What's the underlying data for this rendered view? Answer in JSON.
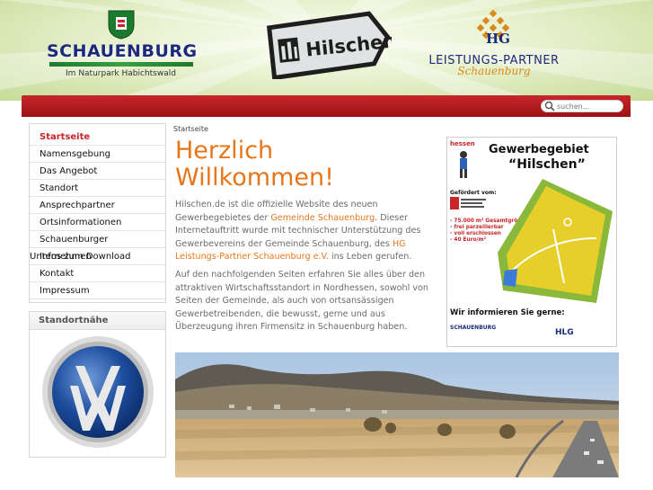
{
  "header": {
    "logo_left": {
      "name": "SCHAUENBURG",
      "subtitle": "Im Naturpark Habichtswald"
    },
    "logo_center": {
      "sign_text": "Hilschen"
    },
    "logo_right": {
      "monogram": "HG",
      "text": "LEISTUNGS-PARTNER",
      "script": "Schauenburg"
    }
  },
  "search": {
    "placeholder": "suchen..."
  },
  "sidebar": {
    "items": [
      {
        "label": "Startseite",
        "active": true
      },
      {
        "label": "Namensgebung",
        "active": false
      },
      {
        "label": "Das Angebot",
        "active": false
      },
      {
        "label": "Standort",
        "active": false
      },
      {
        "label": "Ansprechpartner",
        "active": false
      },
      {
        "label": "Ortsinformationen",
        "active": false
      },
      {
        "label": "Schauenburger",
        "active": false
      },
      {
        "label": "Infos zum Download",
        "active": false
      },
      {
        "label": "Kontakt",
        "active": false
      },
      {
        "label": "Impressum",
        "active": false
      }
    ],
    "overlap_label": "Unternehmen",
    "standort_box_title": "Standortnähe"
  },
  "main": {
    "breadcrumb": "Startseite",
    "title_line1": "Herzlich",
    "title_line2": "Willkommen!",
    "intro_part1": "Hilschen.de ist die offizielle Website des neuen Gewerbegebietes der ",
    "intro_link1": "Gemeinde Schauenburg",
    "intro_part2": ". Dieser Internetauftritt wurde mit technischer Unterstützung des Gewerbevereins der Gemeinde Schauenburg, des ",
    "intro_link2": "HG Leistungs-Partner Schauenburg e.V.",
    "intro_part3": " ins Leben gerufen.",
    "para2": "Auf den nachfolgenden Seiten erfahren Sie alles über den attraktiven Wirtschaftsstandort in Nordhessen, sowohl von Seiten der Gemeinde, als auch von ortsansässigen Gewerbetreibenden, die bewusst, gerne  und aus Überzeugung ihren Firmensitz in Schauenburg haben."
  },
  "flyer": {
    "region": "hessen",
    "title1": "Gewerbegebiet",
    "title2": "“Hilschen”",
    "foerd": "Gefördert vom:",
    "bullets": [
      "- 75.000 m² Gesamtgröße",
      "- frei parzellierbar",
      "- voll erschlossen",
      "- 40 Euro/m²"
    ],
    "bottom": "Wir informieren Sie gerne:",
    "footer_logo": "SCHAUENBURG",
    "footer_hlg": "HLG"
  },
  "colors": {
    "accent_orange": "#e7761b",
    "brand_red": "#c8262a",
    "brand_blue": "#1b2a7a",
    "header_green": "#c6dc98"
  }
}
